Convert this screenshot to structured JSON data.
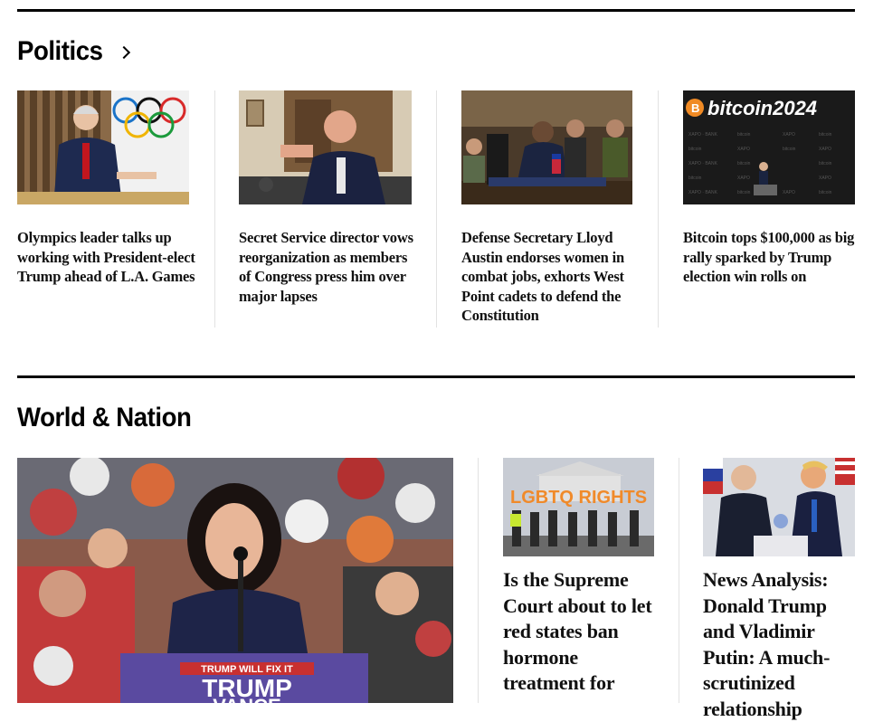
{
  "politics": {
    "title": "Politics",
    "cards": [
      {
        "headline": "Olympics leader talks up working with President-elect Trump ahead of L.A. Games"
      },
      {
        "headline": "Secret Service director vows reorganization as members of Congress press him over major lapses"
      },
      {
        "headline": "Defense Secretary Lloyd Austin endorses women in combat jobs, exhorts West Point cadets to defend the Constitution"
      },
      {
        "headline": "Bitcoin tops $100,000 as big rally sparked by Trump election win rolls on"
      }
    ],
    "bitcoin_logo_text": "bitcoin2024"
  },
  "world": {
    "title": "World & Nation",
    "feature_sign_line1": "TRUMP WILL FIX IT",
    "feature_sign_line2": "TRUMP",
    "feature_sign_line3": "VANCE",
    "cards": [
      {
        "headline": "Is the Supreme Court about to let red states ban hormone treatment for",
        "image_sign": "LGBTQ RIGHTS"
      },
      {
        "headline": "News Analysis: Donald Trump and Vladimir Putin: A much-scrutinized relationship"
      }
    ]
  }
}
